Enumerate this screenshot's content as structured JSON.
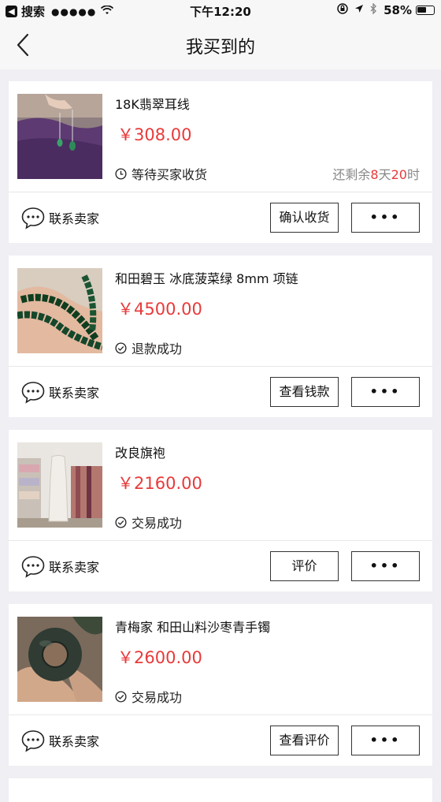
{
  "status_bar": {
    "back_app": "搜索",
    "signal": "●●●●●",
    "time": "下午12:20",
    "battery": "58%"
  },
  "nav": {
    "title": "我买到的"
  },
  "orders": [
    {
      "title": "18K翡翠耳线",
      "price": "￥308.00",
      "status": "等待买家收货",
      "status_icon": "clock-icon",
      "remain_prefix": "还剩余",
      "remain_days": "8",
      "remain_day_unit": "天",
      "remain_hours": "20",
      "remain_hour_unit": "时",
      "contact": "联系卖家",
      "action": "确认收货",
      "more": "•••"
    },
    {
      "title": "和田碧玉 冰底菠菜绿 8mm 项链",
      "price": "￥4500.00",
      "status": "退款成功",
      "status_icon": "check-circle-icon",
      "contact": "联系卖家",
      "action": "查看钱款",
      "more": "•••"
    },
    {
      "title": "改良旗袍",
      "price": "￥2160.00",
      "status": "交易成功",
      "status_icon": "check-circle-icon",
      "contact": "联系卖家",
      "action": "评价",
      "more": "•••"
    },
    {
      "title": "青梅家 和田山料沙枣青手镯",
      "price": "￥2600.00",
      "status": "交易成功",
      "status_icon": "check-circle-icon",
      "contact": "联系卖家",
      "action": "查看评价",
      "more": "•••"
    }
  ],
  "colors": {
    "price": "#e83a3a",
    "background": "#efeff4"
  }
}
